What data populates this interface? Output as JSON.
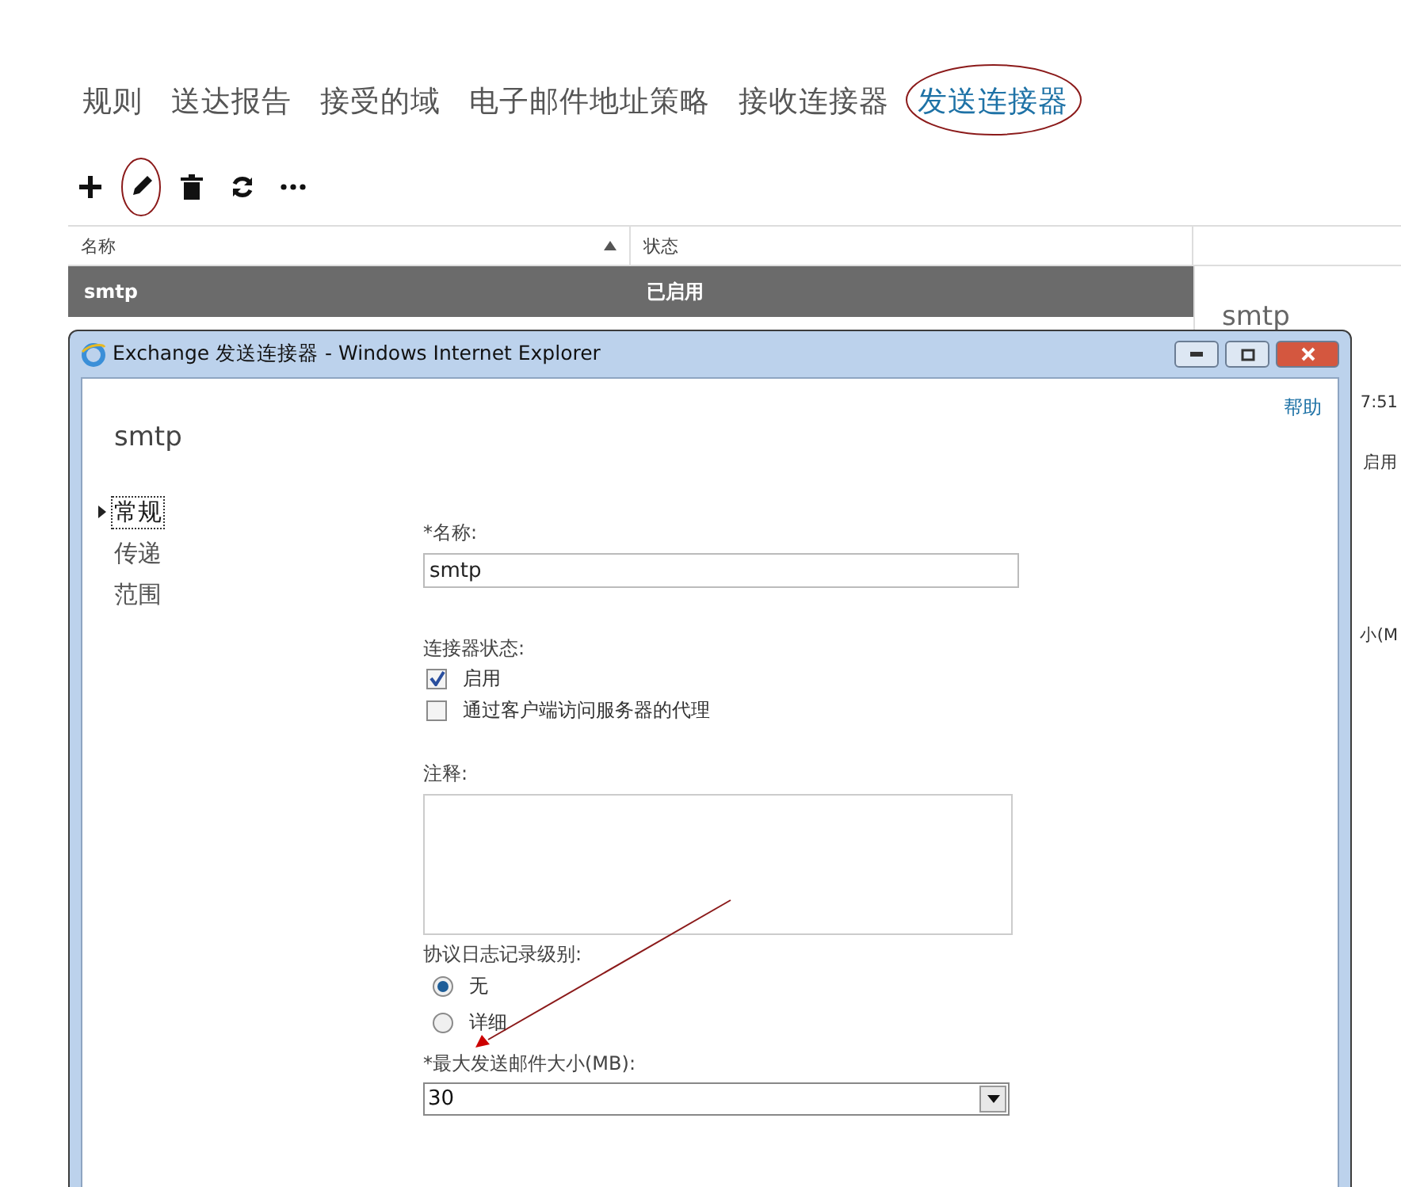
{
  "tabs": [
    {
      "label": "规则",
      "selected": false
    },
    {
      "label": "送达报告",
      "selected": false
    },
    {
      "label": "接受的域",
      "selected": false
    },
    {
      "label": "电子邮件地址策略",
      "selected": false
    },
    {
      "label": "接收连接器",
      "selected": false
    },
    {
      "label": "发送连接器",
      "selected": true
    }
  ],
  "toolbar": [
    {
      "kind": "add"
    },
    {
      "kind": "edit"
    },
    {
      "kind": "delete"
    },
    {
      "kind": "refresh"
    },
    {
      "kind": "more"
    }
  ],
  "table": {
    "columns": [
      {
        "label": "名称",
        "sorted": true
      },
      {
        "label": "状态",
        "sorted": false
      }
    ],
    "rows": [
      {
        "cells": [
          "smtp",
          "已启用"
        ],
        "selected": true
      }
    ]
  },
  "details": {
    "title": "smtp",
    "fragments": [
      "7:51",
      "启用",
      "小(M"
    ]
  },
  "dialog": {
    "title": "Exchange 发送连接器 - Windows Internet Explorer",
    "help": "帮助",
    "heading": "smtp",
    "nav": [
      {
        "label": "常规",
        "selected": true
      },
      {
        "label": "传递",
        "selected": false
      },
      {
        "label": "范围",
        "selected": false
      }
    ],
    "name_label": "*名称:",
    "name_value": "smtp",
    "status_label": "连接器状态:",
    "status_options": [
      {
        "label": "启用",
        "checked": true
      },
      {
        "label": "通过客户端访问服务器的代理",
        "checked": false
      }
    ],
    "comment_label": "注释:",
    "log_label": "协议日志记录级别:",
    "log_options": [
      {
        "label": "无",
        "selected": true
      },
      {
        "label": "详细",
        "selected": false
      }
    ],
    "size_label": "*最大发送邮件大小(MB):",
    "size_value": "30"
  }
}
